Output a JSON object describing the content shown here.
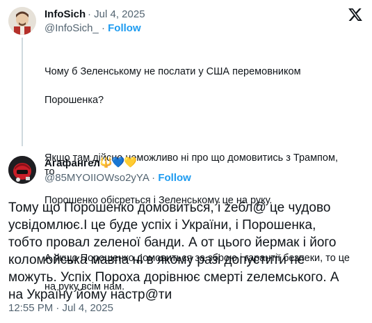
{
  "quoted_tweet": {
    "display_name": "InfoSich",
    "date": "· Jul 4, 2025",
    "handle": "@InfoSich_",
    "follow_label": "Follow",
    "paragraphs": [
      [
        "Чому б Зеленському не послати у США перемовником",
        "Порошенка?"
      ],
      [
        "Якщо там дійсно неможливо ні про що домовитись з Трампом, то",
        "Порошенко обісреться і Зеленському це на руку."
      ],
      [
        "А якщо Порошенко домовиться за зброю і гарантії безпеки, то це",
        "на руку всім нам."
      ]
    ]
  },
  "main_tweet": {
    "display_name": "Агафангел",
    "badges": "🔱💙💛",
    "handle": "@85MYOIIOWso2yYA",
    "follow_label": "Follow",
    "lines": [
      "Тому що Порошенко домовиться, і zебл@ це чудово",
      "усвідомлює.І це буде успіх і України, і Порошенка,",
      "тобто провал zеленої банди. А от цього йермак і його",
      "коломойська мавпа ні в якому разі допустити не",
      "можуть. Успіх Пороха дорівнює смерті zелемського. А",
      "на Україну йому настр@ти"
    ],
    "timestamp": "12:55 PM · Jul 4, 2025"
  },
  "icons": {
    "x_logo": "x-logo-icon",
    "separator": "·"
  },
  "colors": {
    "link_blue": "#1d9bf0",
    "secondary_text": "#536471",
    "thread_line": "#cfd9de"
  }
}
